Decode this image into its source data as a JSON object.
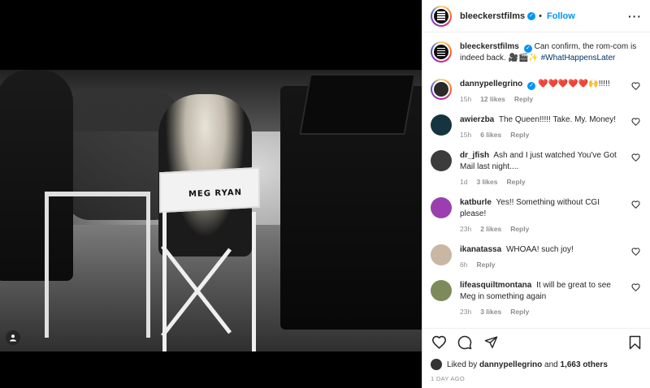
{
  "post": {
    "author": "bleeckerstfilms",
    "follow_label": "Follow",
    "dot": "•",
    "more": "···",
    "chair_text": "MEG RYAN"
  },
  "caption": {
    "username": "bleeckerstfilms",
    "text": "Can confirm, the rom-com is indeed back. 🎥🎬✨ ",
    "hashtag": "#WhatHappensLater"
  },
  "comments": [
    {
      "username": "dannypellegrino",
      "verified": true,
      "text": "❤️❤️❤️❤️❤️🙌!!!!!",
      "time": "15h",
      "likes": "12 likes",
      "reply": "Reply",
      "avatar_color": "#2a2a2a",
      "story": true
    },
    {
      "username": "awierzba",
      "verified": false,
      "text": "The Queen!!!!! Take. My. Money!",
      "time": "15h",
      "likes": "6 likes",
      "reply": "Reply",
      "avatar_color": "#16343f",
      "story": false
    },
    {
      "username": "dr_jfish",
      "verified": false,
      "text": "Ash and I just watched You've Got Mail last night....",
      "time": "1d",
      "likes": "3 likes",
      "reply": "Reply",
      "avatar_color": "#3c3c3c",
      "story": false
    },
    {
      "username": "katburle",
      "verified": false,
      "text": "Yes!! Something without CGI please!",
      "time": "23h",
      "likes": "2 likes",
      "reply": "Reply",
      "avatar_color": "#9b3fb0",
      "story": false
    },
    {
      "username": "ikanatassa",
      "verified": false,
      "text": "WHOAA! such joy!",
      "time": "6h",
      "likes": "",
      "reply": "Reply",
      "avatar_color": "#c9b7a3",
      "story": false
    },
    {
      "username": "lifeasquiltmontana",
      "verified": false,
      "text": "It will be great to see Meg in something again",
      "time": "23h",
      "likes": "3 likes",
      "reply": "Reply",
      "avatar_color": "#7d8a5c",
      "story": false
    }
  ],
  "likes": {
    "prefix": "Liked by ",
    "user": "dannypellegrino",
    "and": " and ",
    "others": "1,663 others"
  },
  "timestamp": "1 DAY AGO",
  "colors": {
    "accent": "#0095f6",
    "muted": "#8e8e8e",
    "text": "#262626"
  },
  "icons": [
    "heart-icon",
    "comment-icon",
    "share-icon",
    "save-icon",
    "more-icon",
    "user-tag-icon",
    "verified-icon"
  ]
}
